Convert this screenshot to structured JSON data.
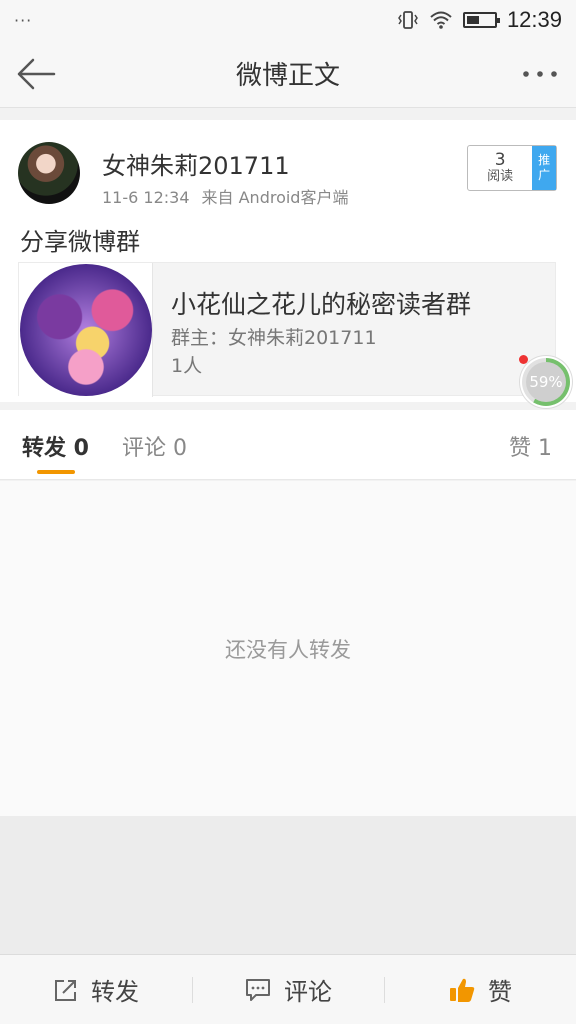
{
  "status_bar": {
    "notification": "···",
    "time": "12:39",
    "battery_level": 0.45,
    "icons": [
      "vibrate-icon",
      "wifi-icon",
      "battery-icon"
    ]
  },
  "nav": {
    "title": "微博正文",
    "back_icon": "back-arrow-icon",
    "more_icon": "more-dots-icon"
  },
  "post": {
    "username": "女神朱莉201711",
    "time": "11-6 12:34",
    "source": "来自 Android客户端",
    "reads": {
      "count": "3",
      "label": "阅读",
      "promote": "推广"
    },
    "text": "分享微博群",
    "group": {
      "name": "小花仙之花儿的秘密读者群",
      "owner": "群主：女神朱莉201711",
      "members": "1人"
    },
    "progress": {
      "label": "59%",
      "value": 0.59
    }
  },
  "tabs": {
    "repost": "转发 0",
    "comment": "评论 0",
    "like": "赞 1"
  },
  "content": {
    "empty_text": "还没有人转发"
  },
  "bottom_bar": {
    "repost": "转发",
    "comment": "评论",
    "like": "赞",
    "accent": "#f29600"
  }
}
